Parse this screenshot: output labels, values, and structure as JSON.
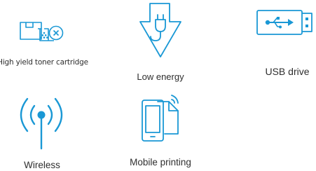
{
  "accent_color": "#1a98d5",
  "features": [
    {
      "label": "High yield toner cartridge",
      "icon": "toner-cartridge-icon"
    },
    {
      "label": "Low energy",
      "icon": "low-energy-plug-icon"
    },
    {
      "label": "USB drive",
      "icon": "usb-drive-icon"
    },
    {
      "label": "Wireless",
      "icon": "wireless-antenna-icon"
    },
    {
      "label": "Mobile printing",
      "icon": "mobile-printing-icon"
    }
  ]
}
